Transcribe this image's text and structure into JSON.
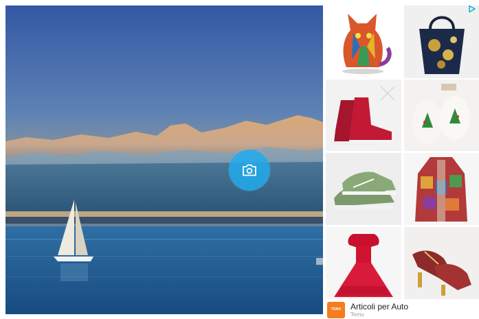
{
  "photo": {
    "description_icon": "camera-icon"
  },
  "ads": {
    "choices_icon": "ad-choices-icon",
    "tiles": [
      {
        "name": "cat-figure"
      },
      {
        "name": "floral-tote-bag"
      },
      {
        "name": "red-winter-boots"
      },
      {
        "name": "christmas-slippers"
      },
      {
        "name": "green-sneakers"
      },
      {
        "name": "patchwork-coat"
      },
      {
        "name": "red-tulle-dress"
      },
      {
        "name": "glitter-dance-shoes"
      }
    ],
    "footer": {
      "brand_logo_text": "TEMU",
      "title": "Articoli per Auto",
      "subtitle": "Temu"
    }
  },
  "colors": {
    "camera_button": "#22aaec",
    "brand_orange": "#f57c1f",
    "ad_choices": "#00aecd"
  }
}
